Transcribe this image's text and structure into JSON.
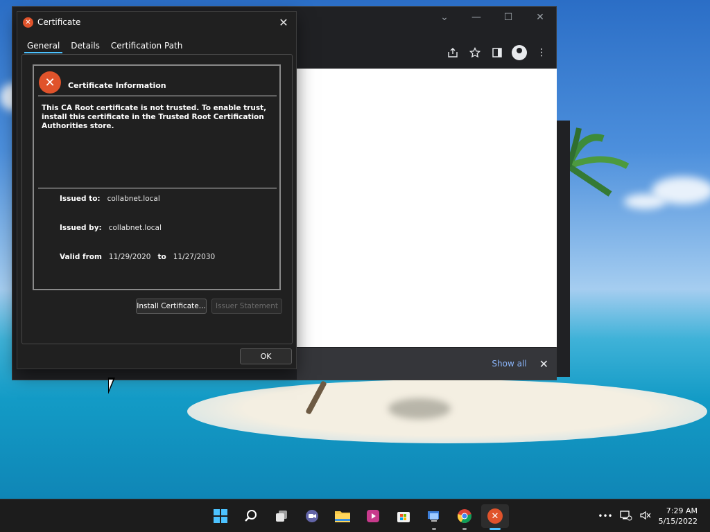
{
  "browser": {
    "controls": {
      "minimize": "—",
      "restore": "☐",
      "close": "✕"
    },
    "download_bar": {
      "show_all_label": "Show all",
      "close_glyph": "✕"
    }
  },
  "dialog": {
    "title": "Certificate",
    "close_glyph": "✕",
    "tabs": [
      {
        "label": "General",
        "active": true
      },
      {
        "label": "Details",
        "active": false
      },
      {
        "label": "Certification Path",
        "active": false
      }
    ],
    "info_title": "Certificate Information",
    "warning": "This CA Root certificate is not trusted. To enable trust, install this certificate in the Trusted Root Certification Authorities store.",
    "issued_to_label": "Issued to:",
    "issued_to": "collabnet.local",
    "issued_by_label": "Issued by:",
    "issued_by": "collabnet.local",
    "valid_from_label": "Valid from",
    "valid_from": "11/29/2020",
    "to_label": "to",
    "valid_to": "11/27/2030",
    "install_button": "Install Certificate...",
    "issuer_statement_button": "Issuer Statement",
    "ok_button": "OK"
  },
  "taskbar": {
    "apps": [
      {
        "name": "start-icon"
      },
      {
        "name": "search-icon"
      },
      {
        "name": "task-view-icon"
      },
      {
        "name": "teams-chat-icon"
      },
      {
        "name": "file-explorer-icon"
      },
      {
        "name": "clipchamp-icon"
      },
      {
        "name": "microsoft-store-icon"
      },
      {
        "name": "remote-desktop-icon"
      },
      {
        "name": "chrome-icon"
      },
      {
        "name": "certificate-app-icon"
      }
    ],
    "tray_overflow": "•••",
    "time": "7:29 AM",
    "date": "5/15/2022"
  },
  "colors": {
    "accent": "#4cc2ff",
    "error": "#e0532b",
    "link": "#8ab4f8"
  }
}
